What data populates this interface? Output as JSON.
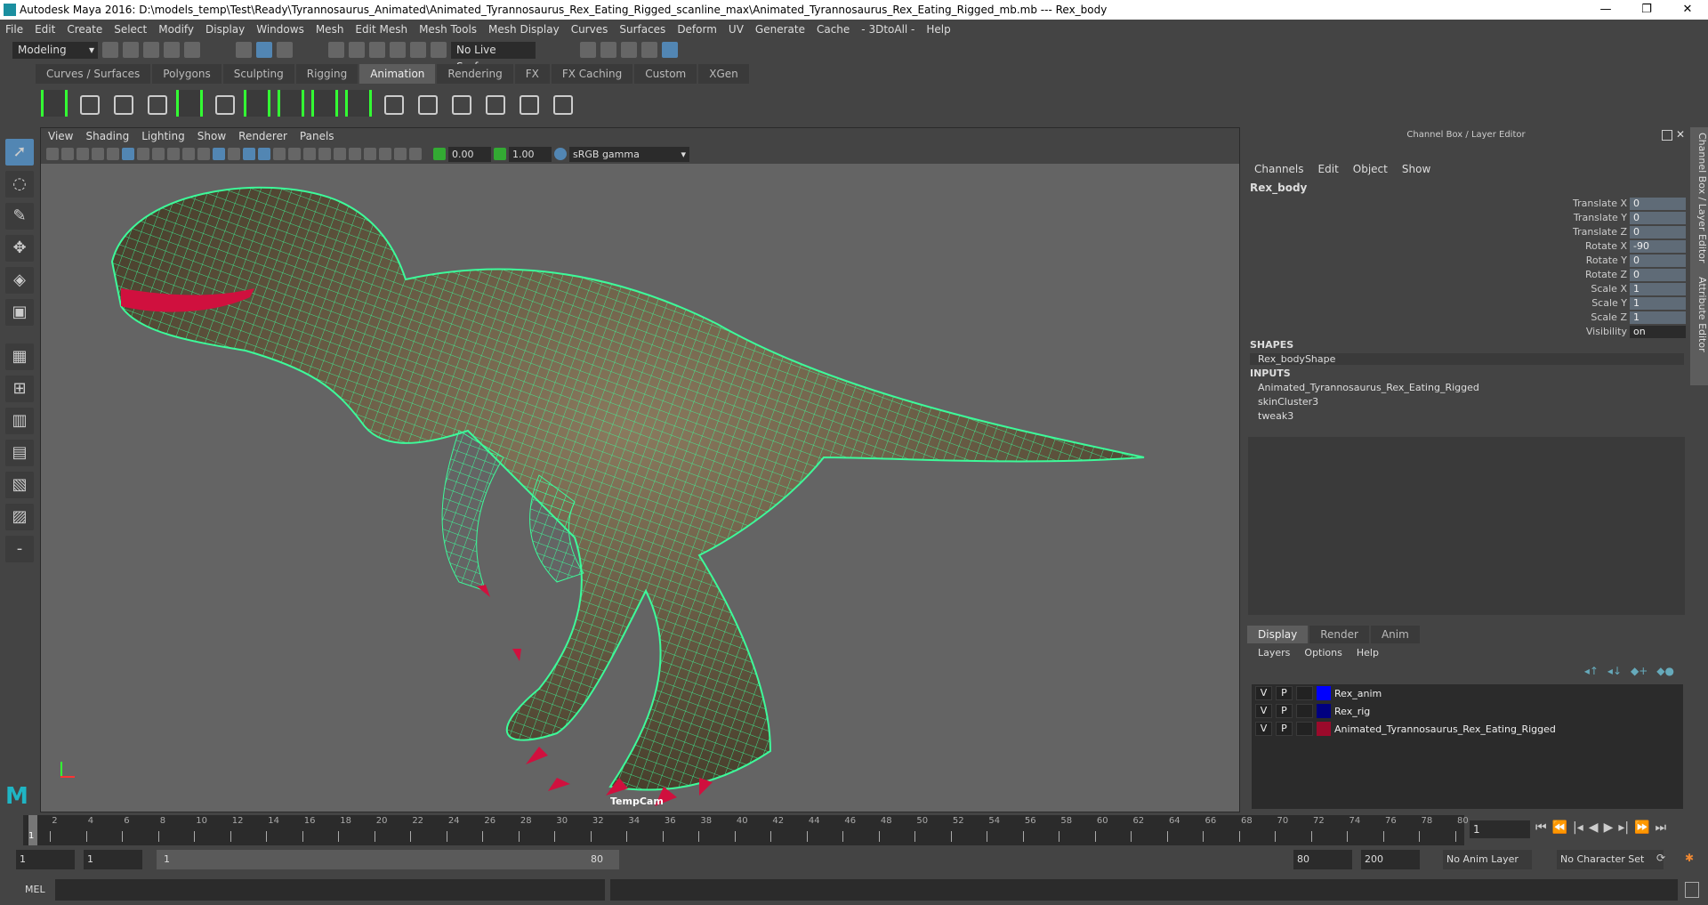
{
  "window": {
    "title": "Autodesk Maya 2016: D:\\models_temp\\Test\\Ready\\Tyrannosaurus_Animated\\Animated_Tyrannosaurus_Rex_Eating_Rigged_scanline_max\\Animated_Tyrannosaurus_Rex_Eating_Rigged_mb.mb   ---   Rex_body",
    "minimize": "—",
    "maximize": "❐",
    "close": "✕"
  },
  "menu": [
    "File",
    "Edit",
    "Create",
    "Select",
    "Modify",
    "Display",
    "Windows",
    "Mesh",
    "Edit Mesh",
    "Mesh Tools",
    "Mesh Display",
    "Curves",
    "Surfaces",
    "Deform",
    "UV",
    "Generate",
    "Cache",
    "- 3DtoAll -",
    "Help"
  ],
  "status": {
    "mode": "Modeling",
    "live_surface": "No Live Surface"
  },
  "shelf_tabs": [
    "Curves / Surfaces",
    "Polygons",
    "Sculpting",
    "Rigging",
    "Animation",
    "Rendering",
    "FX",
    "FX Caching",
    "Custom",
    "XGen"
  ],
  "shelf_active": "Animation",
  "viewport": {
    "menu": [
      "View",
      "Shading",
      "Lighting",
      "Show",
      "Renderer",
      "Panels"
    ],
    "exposure": "0.00",
    "gamma": "1.00",
    "color_space": "sRGB gamma",
    "camera": "TempCam",
    "mesh_color": "#3dfa9a"
  },
  "channel_box": {
    "header": "Channel Box / Layer Editor",
    "menu": [
      "Channels",
      "Edit",
      "Object",
      "Show"
    ],
    "object": "Rex_body",
    "channels": [
      {
        "label": "Translate X",
        "value": "0"
      },
      {
        "label": "Translate Y",
        "value": "0"
      },
      {
        "label": "Translate Z",
        "value": "0"
      },
      {
        "label": "Rotate X",
        "value": "-90"
      },
      {
        "label": "Rotate Y",
        "value": "0"
      },
      {
        "label": "Rotate Z",
        "value": "0"
      },
      {
        "label": "Scale X",
        "value": "1"
      },
      {
        "label": "Scale Y",
        "value": "1"
      },
      {
        "label": "Scale Z",
        "value": "1"
      },
      {
        "label": "Visibility",
        "value": "on"
      }
    ],
    "shapes_label": "SHAPES",
    "shapes": [
      "Rex_bodyShape"
    ],
    "inputs_label": "INPUTS",
    "inputs": [
      "Animated_Tyrannosaurus_Rex_Eating_Rigged",
      "skinCluster3",
      "tweak3"
    ]
  },
  "layer_editor": {
    "tabs": [
      "Display",
      "Render",
      "Anim"
    ],
    "menu": [
      "Layers",
      "Options",
      "Help"
    ],
    "layers": [
      {
        "v": "V",
        "p": "P",
        "name": "Rex_anim",
        "color": "#0000ff"
      },
      {
        "v": "V",
        "p": "P",
        "name": "Rex_rig",
        "color": "#000080"
      },
      {
        "v": "V",
        "p": "P",
        "name": "Animated_Tyrannosaurus_Rex_Eating_Rigged",
        "color": "#9b0a2b"
      }
    ]
  },
  "side_tabs": [
    "Channel Box / Layer Editor",
    "Attribute Editor"
  ],
  "time": {
    "start": 1,
    "end": 80,
    "current": "1",
    "range_start": "1",
    "anim_start": "1",
    "slider_start": "1",
    "slider_end": "80",
    "anim_end": "80",
    "range_end": "200",
    "anim_layer": "No Anim Layer",
    "character_set": "No Character Set"
  },
  "command": {
    "label": "MEL"
  }
}
